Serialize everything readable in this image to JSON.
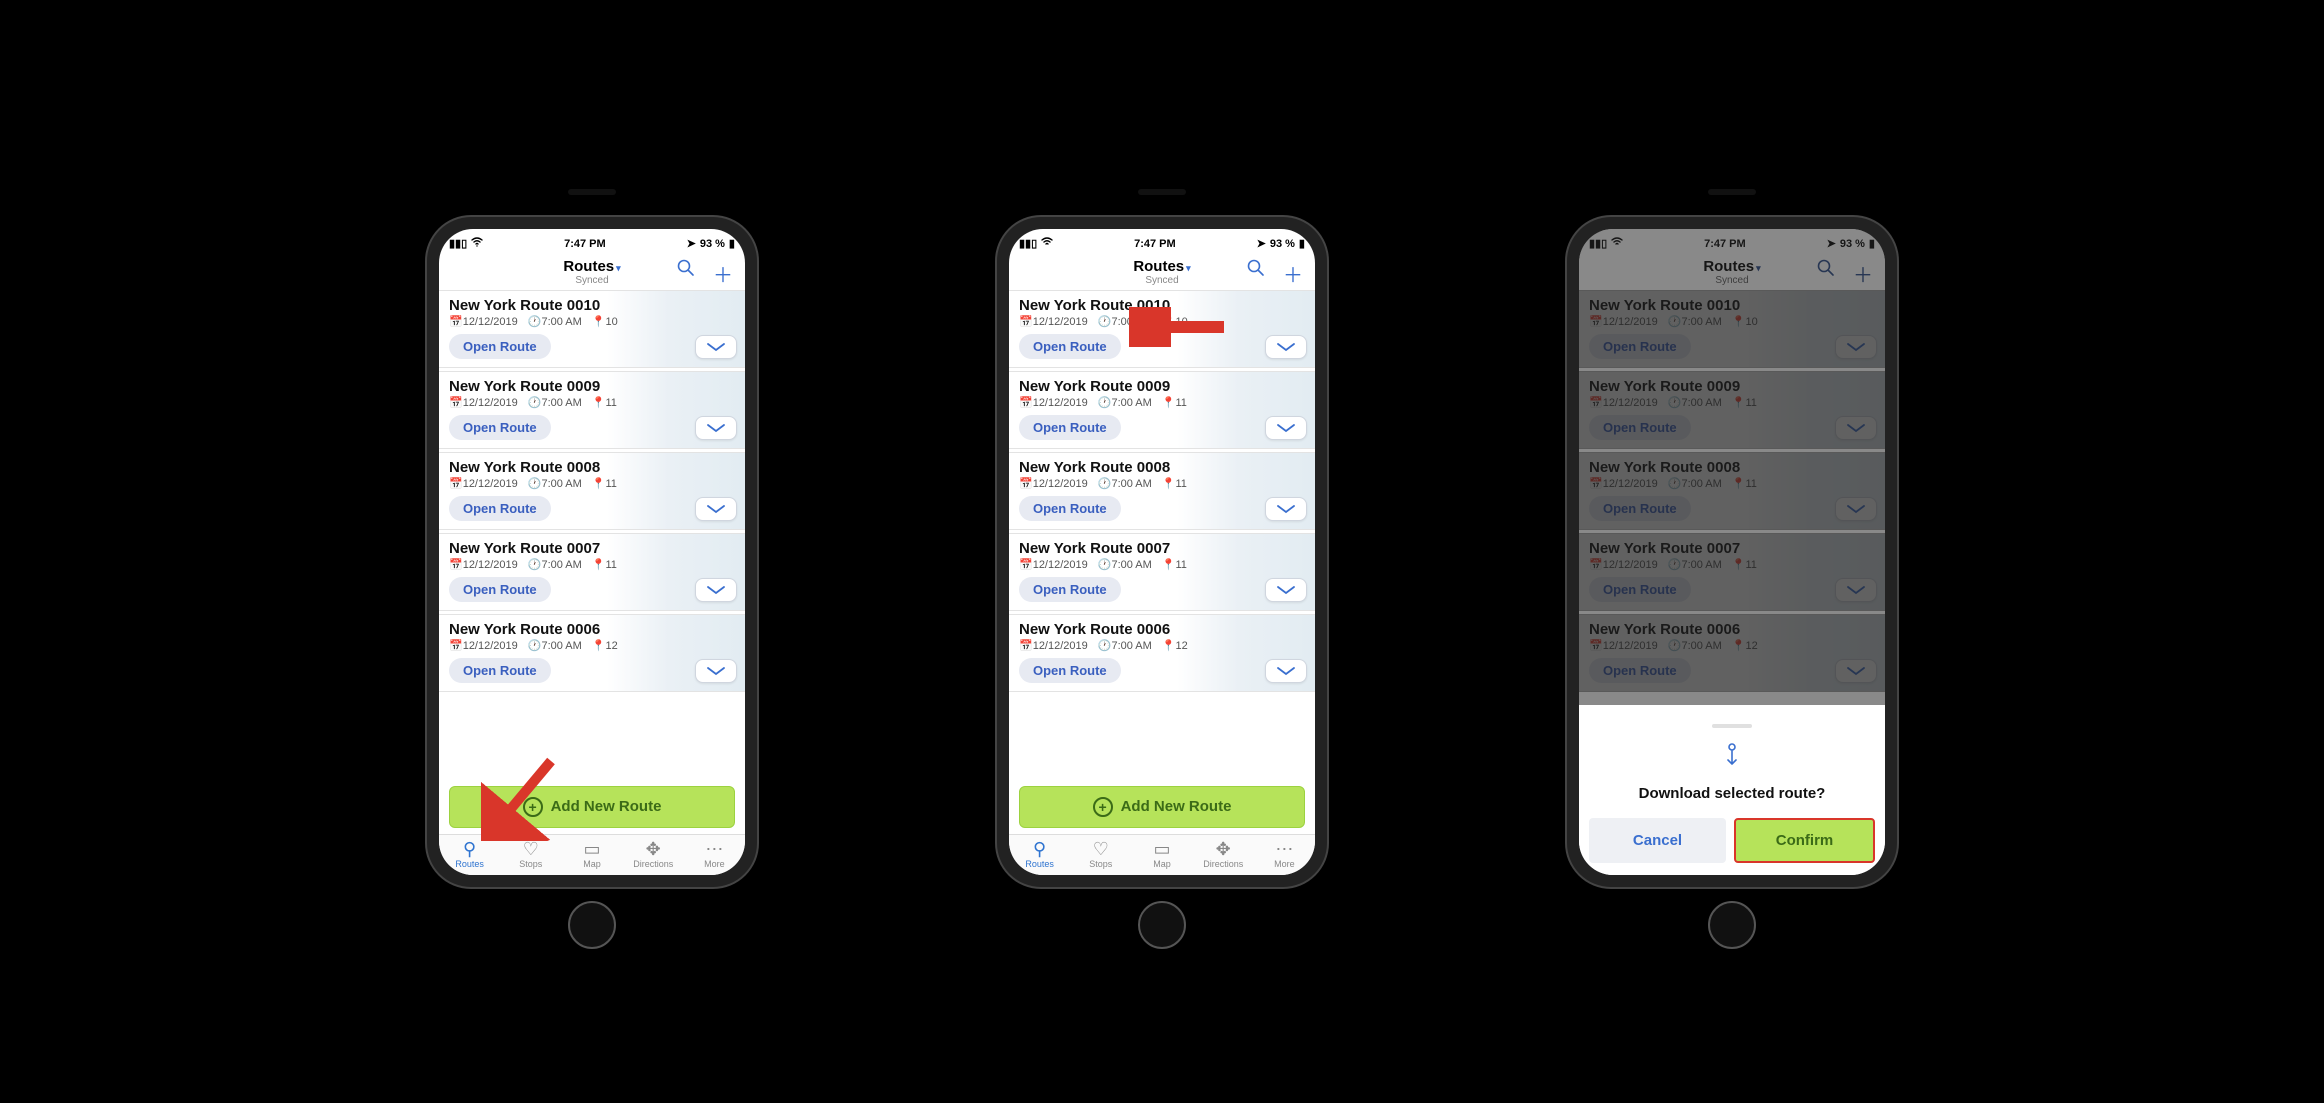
{
  "status": {
    "time": "7:47 PM",
    "battery": "93 %"
  },
  "header": {
    "title": "Routes",
    "subtitle": "Synced"
  },
  "routes": [
    {
      "name": "New York Route 0010",
      "date": "12/12/2019",
      "time": "7:00 AM",
      "stops": "10"
    },
    {
      "name": "New York Route 0009",
      "date": "12/12/2019",
      "time": "7:00 AM",
      "stops": "11"
    },
    {
      "name": "New York Route 0008",
      "date": "12/12/2019",
      "time": "7:00 AM",
      "stops": "11"
    },
    {
      "name": "New York Route 0007",
      "date": "12/12/2019",
      "time": "7:00 AM",
      "stops": "11"
    },
    {
      "name": "New York Route 0006",
      "date": "12/12/2019",
      "time": "7:00 AM",
      "stops": "12"
    }
  ],
  "open_label": "Open Route",
  "add_label": "Add New Route",
  "tabs": [
    {
      "label": "Routes"
    },
    {
      "label": "Stops"
    },
    {
      "label": "Map"
    },
    {
      "label": "Directions"
    },
    {
      "label": "More"
    }
  ],
  "sheet": {
    "title": "Download selected route?",
    "cancel": "Cancel",
    "confirm": "Confirm"
  }
}
